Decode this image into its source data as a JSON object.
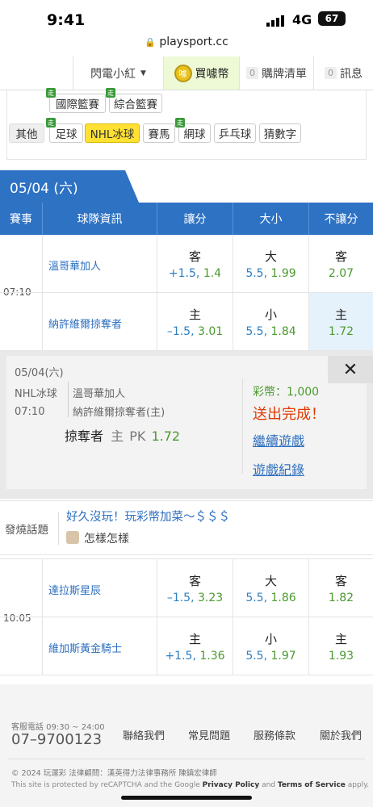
{
  "status": {
    "time": "9:41",
    "network": "4G",
    "battery": "67"
  },
  "url": "playsport.cc",
  "topnav": {
    "user": "閃電小紅",
    "buy": "買噱幣",
    "buy_badge": "噱",
    "cart_count": "0",
    "cart": "購牌清單",
    "msg_count": "0",
    "msg": "訊息"
  },
  "categories": {
    "row1": [
      "國際籃賽",
      "綜合籃賽"
    ],
    "other_label": "其他",
    "row2": [
      "足球",
      "NHL冰球",
      "賽馬",
      "網球",
      "乒乓球",
      "猜數字"
    ],
    "tag": "走"
  },
  "date_tab": "05/04 (六)",
  "table_head": [
    "賽事",
    "球隊資訊",
    "讓分",
    "大小",
    "不讓分"
  ],
  "games": [
    {
      "time": "07:10",
      "teams": [
        {
          "name": "溫哥華加人",
          "spread_lbl": "客",
          "spread": "+1.5, ",
          "spread_odds": "1.4",
          "ou_lbl": "大",
          "ou": "5.5, ",
          "ou_odds": "1.99",
          "ml_lbl": "客",
          "ml": "2.07"
        },
        {
          "name": "納許維爾掠奪者",
          "spread_lbl": "主",
          "spread": "–1.5, ",
          "spread_odds": "3.01",
          "ou_lbl": "小",
          "ou": "5.5, ",
          "ou_odds": "1.84",
          "ml_lbl": "主",
          "ml": "1.72"
        }
      ]
    },
    {
      "time": "10:05",
      "teams": [
        {
          "name": "達拉斯星辰",
          "spread_lbl": "客",
          "spread": "–1.5, ",
          "spread_odds": "3.23",
          "ou_lbl": "大",
          "ou": "5.5, ",
          "ou_odds": "1.86",
          "ml_lbl": "客",
          "ml": "1.82"
        },
        {
          "name": "維加斯黃金騎士",
          "spread_lbl": "主",
          "spread": "+1.5, ",
          "spread_odds": "1.36",
          "ou_lbl": "小",
          "ou": "5.5, ",
          "ou_odds": "1.97",
          "ml_lbl": "主",
          "ml": "1.93"
        }
      ]
    }
  ],
  "popup": {
    "date": "05/04(六)",
    "league": "NHL冰球",
    "time": "07:10",
    "away": "溫哥華加人",
    "home": "納許維爾掠奪者(主)",
    "pick_team": "掠奪者",
    "pick_side": "主",
    "pick_type": "PK",
    "pick_odds": "1.72",
    "coins": "彩幣：1,000",
    "done": "送出完成！",
    "continue": "繼續遊戲",
    "record": "遊戲紀錄",
    "close": "✕"
  },
  "chat": {
    "label": "發燒話題",
    "title": "好久沒玩！玩彩幣加菜～＄＄＄",
    "reply": "怎樣怎樣"
  },
  "footer": {
    "phone_label": "客服電話 09:30 ~ 24:00",
    "phone": "07–9700123",
    "links": [
      "聯絡我們",
      "常見問題",
      "服務條款",
      "關於我們"
    ],
    "copyright": "© 2024 玩運彩 法律顧問：漢英得力法律事務所 陳鎮宏律師",
    "recaptcha_pre": "This site is protected by reCAPTCHA and the Google ",
    "privacy": "Privacy Policy",
    "and": " and ",
    "terms": "Terms of Service",
    "apply": " apply."
  }
}
